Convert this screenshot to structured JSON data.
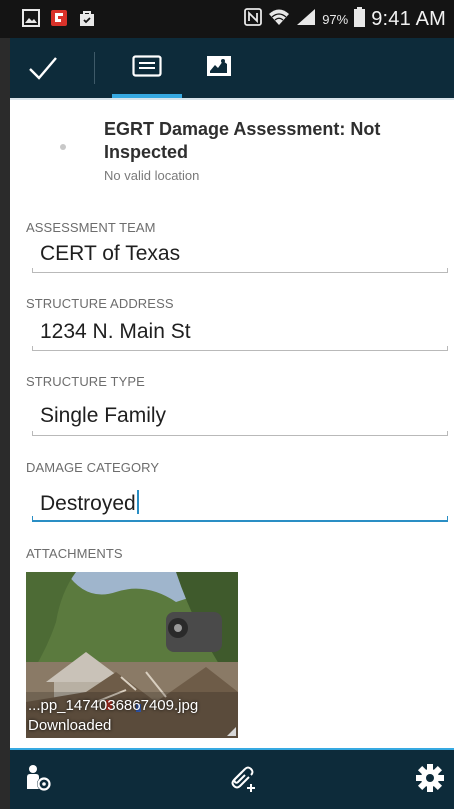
{
  "status_bar": {
    "battery_percent": "97%",
    "time": "9:41 AM",
    "icons": [
      "image-icon",
      "flipboard-icon",
      "bag-icon",
      "nfc-icon",
      "wifi-icon",
      "signal-icon",
      "battery-icon"
    ]
  },
  "toolbar": {
    "confirm_icon": "check-icon",
    "tabs": [
      {
        "icon": "form-icon",
        "active": true
      },
      {
        "icon": "map-icon",
        "active": false
      }
    ],
    "accent": "#36a9e1",
    "background": "#0d2b3a"
  },
  "header": {
    "title": "EGRT Damage Assessment: Not Inspected",
    "subtitle": "No valid location"
  },
  "fields": [
    {
      "label": "ASSESSMENT TEAM",
      "value": "CERT of Texas"
    },
    {
      "label": "STRUCTURE ADDRESS",
      "value": "1234 N. Main St"
    },
    {
      "label": "STRUCTURE TYPE",
      "value": "Single Family"
    },
    {
      "label": "DAMAGE CATEGORY",
      "value": "Destroyed"
    }
  ],
  "attachments": {
    "label": "ATTACHMENTS",
    "items": [
      {
        "name": "...pp_1474036867409.jpg",
        "status": "Downloaded"
      }
    ]
  },
  "bottom_bar": {
    "icons": [
      "collector-settings-icon",
      "add-attachment-icon",
      "gear-icon"
    ]
  }
}
